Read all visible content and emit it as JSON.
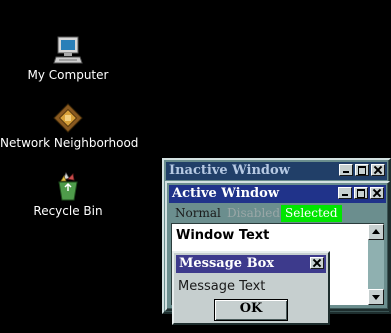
{
  "desktop": {
    "icons": [
      {
        "label": "My Computer",
        "icon": "computer-icon"
      },
      {
        "label": "Network Neighborhood",
        "icon": "network-icon"
      },
      {
        "label": "Recycle Bin",
        "icon": "recycle-bin-icon"
      }
    ],
    "background_color": "#000000"
  },
  "inactive_window": {
    "title": "Inactive Window",
    "title_bg": "#213f68"
  },
  "active_window": {
    "title": "Active Window",
    "title_bg": "#20338a",
    "menu": {
      "normal": "Normal",
      "disabled": "Disabled",
      "selected": "Selected"
    },
    "selected_color": "#00e600",
    "text": "Window Text"
  },
  "message_box": {
    "title": "Message Box",
    "text": "Message Text",
    "ok_label": "OK"
  }
}
